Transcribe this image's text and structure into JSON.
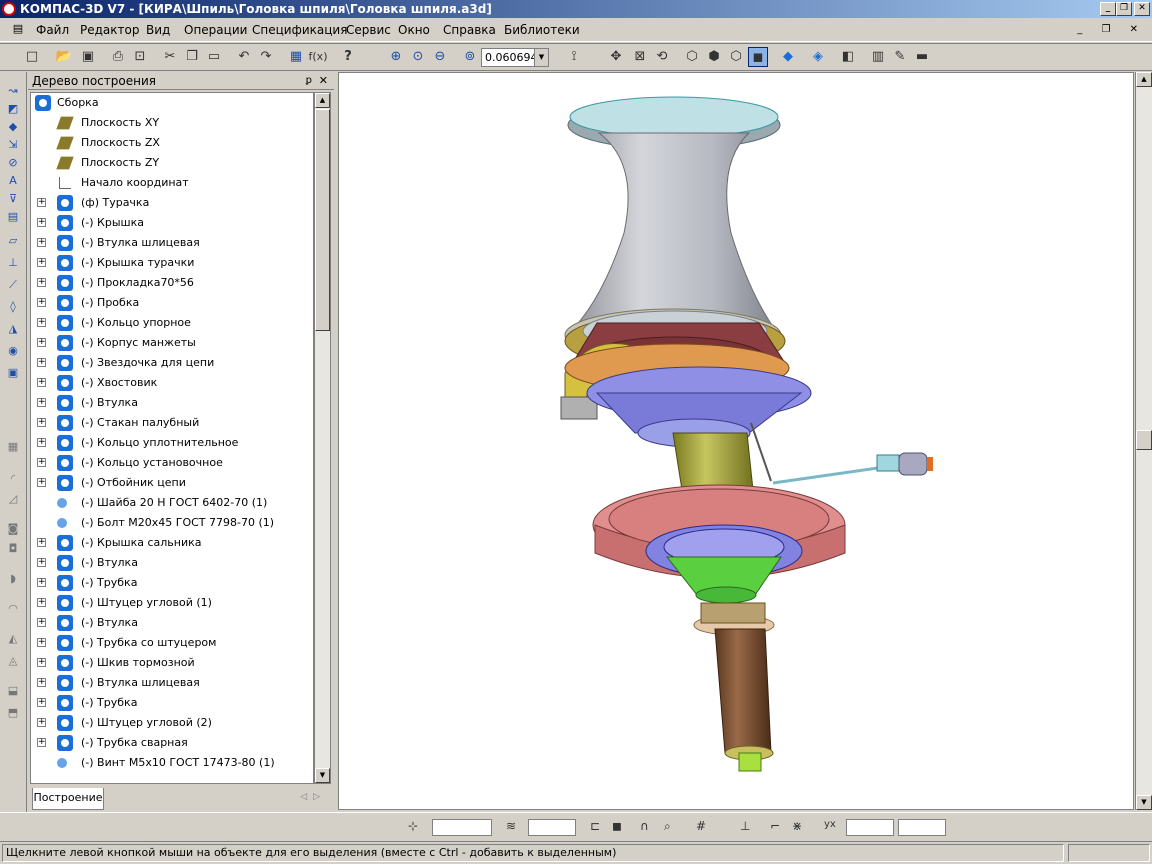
{
  "window": {
    "title": "КОМПАС-3D V7 - [КИРА\\Шпиль\\Головка шпиля\\Головка шпиля.a3d]",
    "minimize": "_",
    "maximize": "❐",
    "close": "✕"
  },
  "menu": {
    "items": [
      "Файл",
      "Редактор",
      "Вид",
      "Операции",
      "Спецификация",
      "Сервис",
      "Окно",
      "Справка",
      "Библиотеки"
    ],
    "mdi_controls": "_ ❐ ✕"
  },
  "toolbar": {
    "zoom_value": "0.060694",
    "icons": [
      "new-icon",
      "open-icon",
      "save-icon",
      "print-icon",
      "preview-icon",
      "cut-icon",
      "copy-icon",
      "paste-icon",
      "undo-icon",
      "redo-icon",
      "variables-icon",
      "function-icon",
      "help-icon",
      "zoom-in-icon",
      "zoom-window-icon",
      "zoom-out-icon",
      "zoom-scale-icon",
      "orientation-icon",
      "pan-icon",
      "zoom-all-icon",
      "rotate-icon",
      "wireframe-icon",
      "hidden-lines-icon",
      "hidden-thin-icon",
      "shaded-icon",
      "shaded-edges-icon",
      "perspective-icon",
      "section-icon",
      "properties-icon",
      "layers-icon"
    ]
  },
  "tree": {
    "title": "Дерево построения",
    "pin": "ꝑ",
    "close": "✕",
    "root": "Сборка",
    "items": [
      {
        "type": "plane",
        "label": "Плоскость XY",
        "expandable": false
      },
      {
        "type": "plane",
        "label": "Плоскость ZX",
        "expandable": false
      },
      {
        "type": "plane",
        "label": "Плоскость ZY",
        "expandable": false
      },
      {
        "type": "origin",
        "label": "Начало координат",
        "expandable": false
      },
      {
        "type": "part",
        "label": "(ф) Турачка",
        "expandable": true
      },
      {
        "type": "part",
        "label": "(-) Крышка",
        "expandable": true
      },
      {
        "type": "part",
        "label": "(-) Втулка шлицевая",
        "expandable": true
      },
      {
        "type": "part",
        "label": "(-) Крышка турачки",
        "expandable": true
      },
      {
        "type": "part",
        "label": "(-) Прокладка70*56",
        "expandable": true
      },
      {
        "type": "part",
        "label": "(-) Пробка",
        "expandable": true
      },
      {
        "type": "part",
        "label": "(-) Кольцо упорное",
        "expandable": true
      },
      {
        "type": "part",
        "label": "(-) Корпус манжеты",
        "expandable": true
      },
      {
        "type": "part",
        "label": "(-) Звездочка для цепи",
        "expandable": true
      },
      {
        "type": "part",
        "label": "(-) Хвостовик",
        "expandable": true
      },
      {
        "type": "part",
        "label": "(-) Втулка",
        "expandable": true
      },
      {
        "type": "part",
        "label": "(-) Стакан палубный",
        "expandable": true
      },
      {
        "type": "part",
        "label": "(-) Кольцо уплотнительное",
        "expandable": true
      },
      {
        "type": "part",
        "label": "(-) Кольцо установочное",
        "expandable": true
      },
      {
        "type": "part",
        "label": "(-) Отбойник цепи",
        "expandable": true
      },
      {
        "type": "std",
        "label": "(-) Шайба 20 Н ГОСТ 6402-70 (1)",
        "expandable": false
      },
      {
        "type": "std",
        "label": "(-) Болт М20х45 ГОСТ 7798-70 (1)",
        "expandable": false
      },
      {
        "type": "part",
        "label": "(-) Крышка сальника",
        "expandable": true
      },
      {
        "type": "part",
        "label": "(-) Втулка",
        "expandable": true
      },
      {
        "type": "part",
        "label": "(-) Трубка",
        "expandable": true
      },
      {
        "type": "part",
        "label": "(-) Штуцер угловой (1)",
        "expandable": true
      },
      {
        "type": "part",
        "label": "(-) Втулка",
        "expandable": true
      },
      {
        "type": "part",
        "label": "(-) Трубка со штуцером",
        "expandable": true
      },
      {
        "type": "part",
        "label": "(-) Шкив тормозной",
        "expandable": true
      },
      {
        "type": "part",
        "label": "(-) Втулка шлицевая",
        "expandable": true
      },
      {
        "type": "part",
        "label": "(-) Трубка",
        "expandable": true
      },
      {
        "type": "part",
        "label": "(-) Штуцер угловой (2)",
        "expandable": true
      },
      {
        "type": "part",
        "label": "(-) Трубка сварная",
        "expandable": true
      },
      {
        "type": "std",
        "label": "(-) Винт М5х10 ГОСТ 17473-80 (1)",
        "expandable": false
      }
    ],
    "tab": "Построение"
  },
  "status": {
    "text": "Щелкните левой кнопкой мыши на объекте для его выделения (вместе с Ctrl - добавить к выделенным)"
  }
}
